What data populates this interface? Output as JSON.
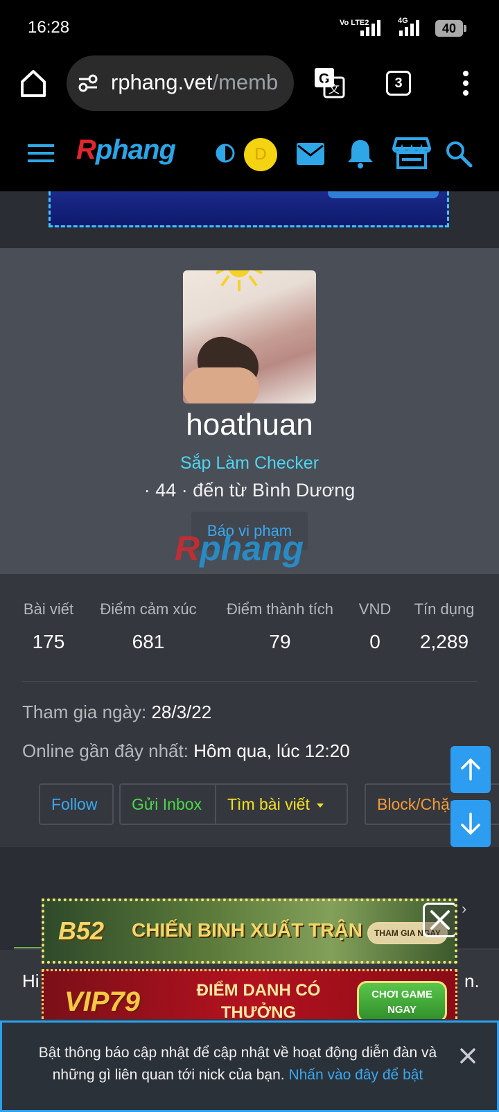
{
  "status_bar": {
    "time": "16:28",
    "network_left": "Vo LTE2",
    "network_right": "4G",
    "battery": "40"
  },
  "browser": {
    "url_host": "rphang.vet",
    "url_path": "/memb",
    "tab_count": "3"
  },
  "site_header": {
    "logo_first": "R",
    "logo_rest": "phang",
    "avatar_letter": "D"
  },
  "profile": {
    "username": "hoathuan",
    "user_title": "Sắp Làm Checker",
    "meta": "· 44 · đến từ Bình Dương",
    "report_label": "Báo vi phạm",
    "watermark_first": "R",
    "watermark_rest": "phang"
  },
  "stats": [
    {
      "label": "Bài viết",
      "value": "175"
    },
    {
      "label": "Điểm cảm xúc",
      "value": "681"
    },
    {
      "label": "Điểm thành tích",
      "value": "79"
    },
    {
      "label": "VND",
      "value": "0"
    },
    {
      "label": "Tín dụng",
      "value": "2,289"
    }
  ],
  "joined": {
    "label": "Tham gia ngày:",
    "value": "28/3/22"
  },
  "last_seen": {
    "label": "Online gần đây nhất:",
    "value": "Hôm qua, lúc 12:20"
  },
  "actions": {
    "follow": "Follow",
    "inbox": "Gửi Inbox",
    "find_posts": "Tìm bài viết",
    "block": "Block/Chặn"
  },
  "lower": {
    "hi_start": "Hi",
    "hi_end": "n."
  },
  "ads": {
    "ad1_brand": "B52",
    "ad1_text": "CHIẾN BINH XUẤT TRẬN",
    "ad1_cta": "THAM GIA NGAY",
    "ad2_brand": "VIP79",
    "ad2_text": "ĐIỂM DANH CÓ THƯỞNG",
    "ad2_cta": "CHƠI GAME NGAY"
  },
  "notification": {
    "text": "Bật thông báo cập nhật để cập nhật về hoạt động diễn đàn và những gì liên quan tới nick của bạn.",
    "link": "Nhấn vào đây để bật"
  }
}
